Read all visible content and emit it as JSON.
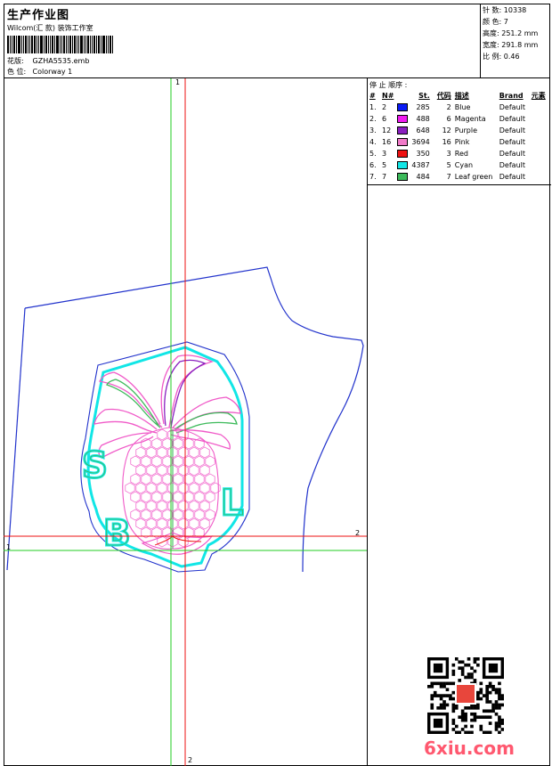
{
  "header": {
    "title": "生产作业图",
    "company": "Wilcom(汇 款) 装饰工作室",
    "design_label": "花版:",
    "design_value": "GZHA5535.emb",
    "colorway_label": "色 位:",
    "colorway_value": "Colorway 1"
  },
  "stats": [
    {
      "label": "针 数:",
      "value": "10338"
    },
    {
      "label": "颜 色:",
      "value": "7"
    },
    {
      "label": "高度:",
      "value": "251.2 mm"
    },
    {
      "label": "宽度:",
      "value": "291.8 mm"
    },
    {
      "label": "比 例:",
      "value": "0.46"
    }
  ],
  "stop_sequence": {
    "title": "停 止 顺序 :",
    "columns": [
      "#",
      "N#",
      "St.",
      "代码",
      "描述",
      "Brand",
      "元素"
    ],
    "rows": [
      {
        "idx": "1.",
        "n": "2",
        "color": "#0a1bf5",
        "st": "285",
        "code": "2",
        "desc": "Blue",
        "brand": "Default"
      },
      {
        "idx": "2.",
        "n": "6",
        "color": "#f01cf0",
        "st": "488",
        "code": "6",
        "desc": "Magenta",
        "brand": "Default"
      },
      {
        "idx": "3.",
        "n": "12",
        "color": "#8a1fbf",
        "st": "648",
        "code": "12",
        "desc": "Purple",
        "brand": "Default"
      },
      {
        "idx": "4.",
        "n": "16",
        "color": "#f07ac8",
        "st": "3694",
        "code": "16",
        "desc": "Pink",
        "brand": "Default"
      },
      {
        "idx": "5.",
        "n": "3",
        "color": "#ee1111",
        "st": "350",
        "code": "3",
        "desc": "Red",
        "brand": "Default"
      },
      {
        "idx": "6.",
        "n": "5",
        "color": "#11e6e6",
        "st": "4387",
        "code": "5",
        "desc": "Cyan",
        "brand": "Default"
      },
      {
        "idx": "7.",
        "n": "7",
        "color": "#3cba5a",
        "st": "484",
        "code": "7",
        "desc": "Leaf green",
        "brand": "Default"
      }
    ]
  },
  "axes": {
    "v_label": "1",
    "h_label": "2",
    "v_bottom_label": "2",
    "h_left_label": "1"
  },
  "watermark": {
    "text": "6xiu.com"
  }
}
